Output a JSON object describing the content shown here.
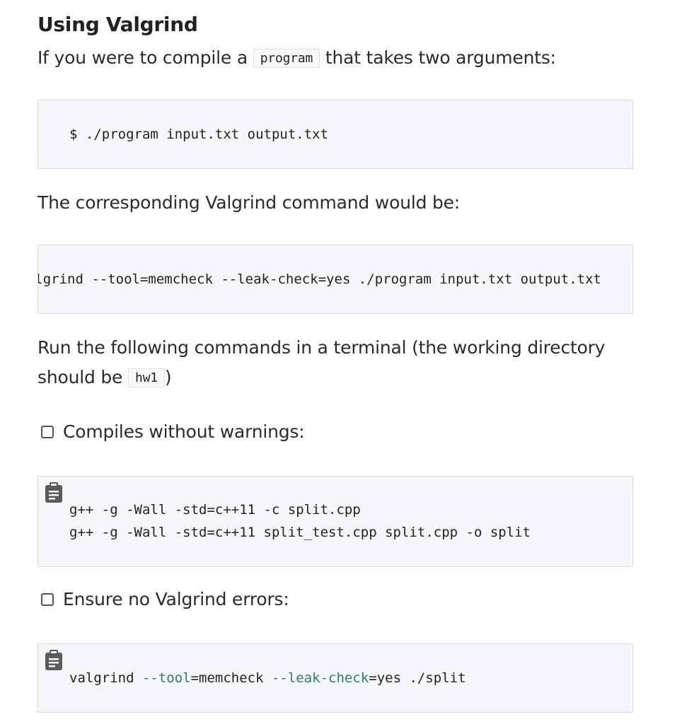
{
  "heading": "Using Valgrind",
  "intro": {
    "before": "If you were to compile a ",
    "code": "program",
    "after": " that takes two arguments:"
  },
  "run_example": "$ ./program input.txt output.txt",
  "corresponding_text": "The corresponding Valgrind command would be:",
  "valgrind_example": "valgrind --tool=memcheck --leak-check=yes ./program input.txt output.txt",
  "run_commands": {
    "line1": "Run the following commands in a terminal (the working directory",
    "line2_before": "should be ",
    "line2_code": "hw1",
    "line2_after": ")"
  },
  "checklist": [
    {
      "label": "Compiles without warnings:",
      "checked": false,
      "commands": [
        "g++ -g -Wall -std=c++11 -c split.cpp",
        "g++ -g -Wall -std=c++11 split_test.cpp split.cpp -o split"
      ]
    },
    {
      "label": "Ensure no Valgrind errors:",
      "checked": false,
      "command": {
        "t1": "valgrind ",
        "t2": "--tool",
        "t3": "=memcheck ",
        "t4": "--leak-check",
        "t5": "=yes ./split"
      }
    }
  ],
  "icons": {
    "copy": "clipboard-icon"
  },
  "colors": {
    "code_bg": "#f4f6fa",
    "code_border": "#d6dde8",
    "option_token": "#2d7a78"
  }
}
